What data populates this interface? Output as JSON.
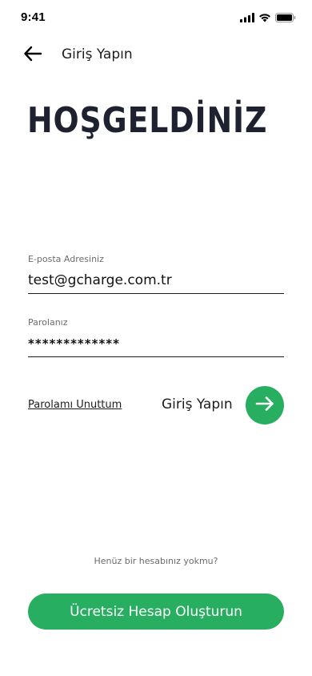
{
  "status_bar": {
    "time": "9:41",
    "icons": [
      "cellular-signal-icon",
      "wifi-icon",
      "battery-icon"
    ]
  },
  "nav": {
    "back_icon": "arrow-left-icon",
    "title": "Giriş Yapın"
  },
  "hero": {
    "title": "HOŞGELDİNİZ"
  },
  "form": {
    "email": {
      "label": "E-posta Adresiniz",
      "value": "test@gcharge.com.tr"
    },
    "password": {
      "label": "Parolanız",
      "value": "*************"
    },
    "forgot_link": "Parolamı Unuttum",
    "login_label": "Giriş Yapın",
    "login_icon": "arrow-right-icon"
  },
  "signup": {
    "prompt": "Henüz bir hesabınız yokmu?",
    "button_label": "Ücretsiz Hesap Oluşturun"
  },
  "colors": {
    "accent": "#27ae60",
    "text_dark": "#1e2230",
    "muted": "#6b6b6b",
    "background": "#ffffff"
  }
}
